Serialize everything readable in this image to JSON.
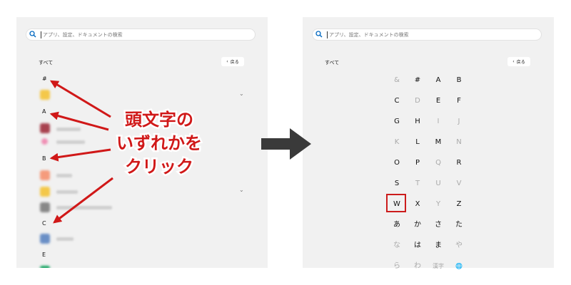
{
  "search": {
    "placeholder": "アプリ、設定、ドキュメントの検索"
  },
  "list": {
    "all_label": "すべて",
    "back_label": "戻る",
    "headers": [
      "#",
      "A",
      "B",
      "C",
      "E"
    ]
  },
  "grid": {
    "cells": [
      {
        "label": "&",
        "enabled": false
      },
      {
        "label": "#",
        "enabled": true
      },
      {
        "label": "A",
        "enabled": true
      },
      {
        "label": "B",
        "enabled": true
      },
      {
        "label": "C",
        "enabled": true
      },
      {
        "label": "D",
        "enabled": false
      },
      {
        "label": "E",
        "enabled": true
      },
      {
        "label": "F",
        "enabled": true
      },
      {
        "label": "G",
        "enabled": true
      },
      {
        "label": "H",
        "enabled": true
      },
      {
        "label": "I",
        "enabled": false
      },
      {
        "label": "J",
        "enabled": false
      },
      {
        "label": "K",
        "enabled": false
      },
      {
        "label": "L",
        "enabled": true
      },
      {
        "label": "M",
        "enabled": true
      },
      {
        "label": "N",
        "enabled": false
      },
      {
        "label": "O",
        "enabled": true
      },
      {
        "label": "P",
        "enabled": true
      },
      {
        "label": "Q",
        "enabled": false
      },
      {
        "label": "R",
        "enabled": true
      },
      {
        "label": "S",
        "enabled": true
      },
      {
        "label": "T",
        "enabled": false
      },
      {
        "label": "U",
        "enabled": false
      },
      {
        "label": "V",
        "enabled": false
      },
      {
        "label": "W",
        "enabled": true
      },
      {
        "label": "X",
        "enabled": true
      },
      {
        "label": "Y",
        "enabled": false
      },
      {
        "label": "Z",
        "enabled": true
      },
      {
        "label": "あ",
        "enabled": true
      },
      {
        "label": "か",
        "enabled": true
      },
      {
        "label": "さ",
        "enabled": true
      },
      {
        "label": "た",
        "enabled": true
      },
      {
        "label": "な",
        "enabled": false
      },
      {
        "label": "は",
        "enabled": true
      },
      {
        "label": "ま",
        "enabled": true
      },
      {
        "label": "や",
        "enabled": false
      },
      {
        "label": "ら",
        "enabled": false
      },
      {
        "label": "わ",
        "enabled": false
      },
      {
        "label": "漢字",
        "enabled": false
      },
      {
        "label": "🌐",
        "enabled": false
      }
    ],
    "highlighted": "W"
  },
  "annotation": {
    "lines": [
      "頭文字の",
      "いずれかを",
      "クリック"
    ]
  },
  "colors": {
    "accent": "#0067c0",
    "annotation_red": "#d01818",
    "panel_bg": "#f1f1f1"
  },
  "blurred_app_icon_colors": [
    "#f4c84a",
    "#a8424f",
    "#ef8fb4",
    "#f59b7c",
    "#f4c84a",
    "#888888",
    "#6a8fc6",
    "#19a463"
  ]
}
